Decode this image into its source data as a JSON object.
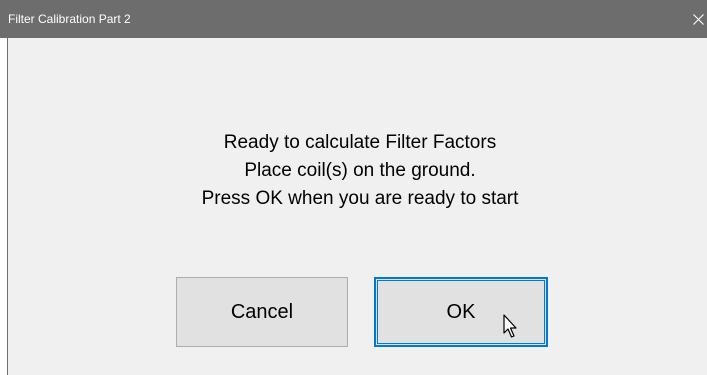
{
  "window": {
    "title": "Filter Calibration Part 2",
    "close_symbol": "✕"
  },
  "message": {
    "line1": "Ready to calculate Filter Factors",
    "line2": "Place coil(s) on the ground.",
    "line3": "Press OK when you are ready to start"
  },
  "buttons": {
    "cancel_label": "Cancel",
    "ok_label": "OK"
  },
  "icons": {
    "close": "close-icon",
    "cursor": "mouse-cursor-icon"
  },
  "colors": {
    "titlebar": "#6d6d6d",
    "dialog_background": "#f0f0f0",
    "button_face": "#e1e1e1",
    "focus_border": "#0078d7"
  }
}
